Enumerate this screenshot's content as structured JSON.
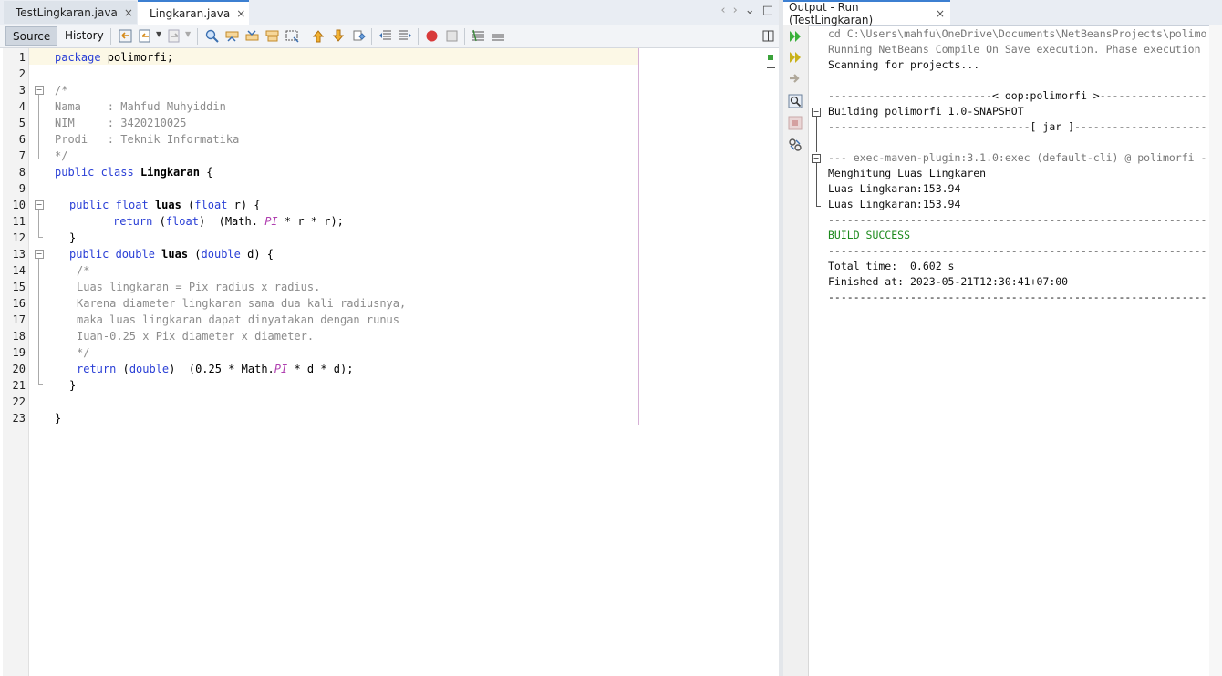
{
  "editor": {
    "tabs": [
      {
        "label": "TestLingkaran.java",
        "active": false,
        "close": "×"
      },
      {
        "label": "Lingkaran.java",
        "active": true,
        "close": "×"
      }
    ],
    "tab_nav": {
      "prev": "‹",
      "next": "›",
      "menu": "⌄",
      "maximize": "□"
    },
    "toolbar": {
      "source_label": "Source",
      "history_label": "History"
    },
    "line_numbers": [
      "1",
      "2",
      "3",
      "4",
      "5",
      "6",
      "7",
      "8",
      "9",
      "10",
      "11",
      "12",
      "13",
      "14",
      "15",
      "16",
      "17",
      "18",
      "19",
      "20",
      "21",
      "22",
      "23"
    ],
    "code": {
      "l1_kw": "package",
      "l1_rest": " polimorfi;",
      "l3": "/*",
      "l4": "Nama    : Mahfud Muhyiddin",
      "l5": "NIM     : 3420210025",
      "l6": "Prodi   : Teknik Informatika",
      "l7": "*/",
      "l8_kw": "public class",
      "l8_name": "Lingkaran",
      "l8_rest": " {",
      "l10_kw": "public float",
      "l10_name": "luas",
      "l10_p1": " (",
      "l10_type": "float",
      "l10_p2": " r) {",
      "l11_kw": "return",
      "l11_p1": " (",
      "l11_type": "float",
      "l11_p2": ")  (Math. ",
      "l11_const": "PI",
      "l11_p3": " * r * r);",
      "l12": "}",
      "l13_kw": "public double",
      "l13_name": "luas",
      "l13_p1": " (",
      "l13_type": "double",
      "l13_p2": " d) {",
      "l14": "/*",
      "l15": "Luas lingkaran = Pix radius x radius.",
      "l16": "Karena diameter lingkaran sama dua kali radiusnya,",
      "l17": "maka luas lingkaran dapat dinyatakan dengan runus",
      "l18": "Iuan-0.25 x Pix diameter x diameter.",
      "l19": "*/",
      "l20_kw": "return",
      "l20_p1": " (",
      "l20_type": "double",
      "l20_p2": ")  (0.25 * Math.",
      "l20_const": "PI",
      "l20_p3": " * d * d);",
      "l21": "}",
      "l23": "}"
    }
  },
  "output": {
    "tab_label": "Output - Run (TestLingkaran)",
    "tab_close": "×",
    "lines": [
      {
        "text": "cd C:\\Users\\mahfu\\OneDrive\\Documents\\NetBeansProjects\\polimo",
        "style": "grey"
      },
      {
        "text": "Running NetBeans Compile On Save execution. Phase execution",
        "style": "grey"
      },
      {
        "text": "Scanning for projects...",
        "style": "normal"
      },
      {
        "text": "",
        "style": "normal"
      },
      {
        "text": "--------------------------< oop:polimorfi >-----------------",
        "style": "normal"
      },
      {
        "text": "Building polimorfi 1.0-SNAPSHOT",
        "style": "normal"
      },
      {
        "text": "--------------------------------[ jar ]---------------------",
        "style": "normal"
      },
      {
        "text": "",
        "style": "normal"
      },
      {
        "text": "--- exec-maven-plugin:3.1.0:exec (default-cli) @ polimorfi -",
        "style": "grey"
      },
      {
        "text": "Menghitung Luas Lingkaren",
        "style": "normal"
      },
      {
        "text": "Luas Lingkaran:153.94",
        "style": "normal"
      },
      {
        "text": "Luas Lingkaran:153.94",
        "style": "normal"
      },
      {
        "text": "------------------------------------------------------------",
        "style": "normal"
      },
      {
        "text": "BUILD SUCCESS",
        "style": "green"
      },
      {
        "text": "------------------------------------------------------------",
        "style": "normal"
      },
      {
        "text": "Total time:  0.602 s",
        "style": "normal"
      },
      {
        "text": "Finished at: 2023-05-21T12:30:41+07:00",
        "style": "normal"
      },
      {
        "text": "------------------------------------------------------------",
        "style": "normal"
      }
    ]
  },
  "colors": {
    "keyword": "#2a3fd6",
    "comment": "#8c8c8c",
    "constant": "#b040b0",
    "success": "#1c8a1c",
    "tab_accent": "#3c7fd1"
  }
}
